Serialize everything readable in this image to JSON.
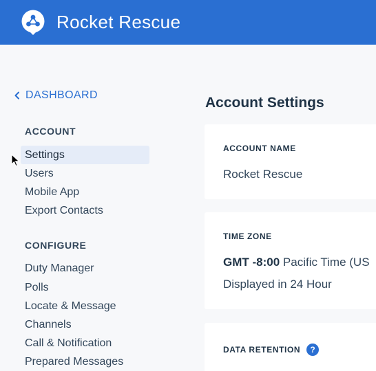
{
  "app": {
    "title": "Rocket Rescue",
    "brand_color": "#2a6fd2"
  },
  "sidebar": {
    "back_link": {
      "label": "DASHBOARD",
      "icon": "chevron-left-icon"
    },
    "sections": [
      {
        "heading": "ACCOUNT",
        "items": [
          {
            "label": "Settings",
            "active": true
          },
          {
            "label": "Users"
          },
          {
            "label": "Mobile App"
          },
          {
            "label": "Export Contacts"
          }
        ]
      },
      {
        "heading": "CONFIGURE",
        "items": [
          {
            "label": "Duty Manager"
          },
          {
            "label": "Polls"
          },
          {
            "label": "Locate & Message"
          },
          {
            "label": "Channels"
          },
          {
            "label": "Call & Notification"
          },
          {
            "label": "Prepared Messages"
          }
        ]
      }
    ]
  },
  "main": {
    "title": "Account Settings",
    "cards": {
      "account_name": {
        "label": "ACCOUNT NAME",
        "value": "Rocket Rescue"
      },
      "time_zone": {
        "label": "TIME ZONE",
        "offset": "GMT -8:00",
        "zone_name": " Pacific Time (US",
        "format": "Displayed in 24 Hour"
      },
      "data_retention": {
        "label": "DATA RETENTION",
        "help_icon": "?"
      }
    }
  }
}
